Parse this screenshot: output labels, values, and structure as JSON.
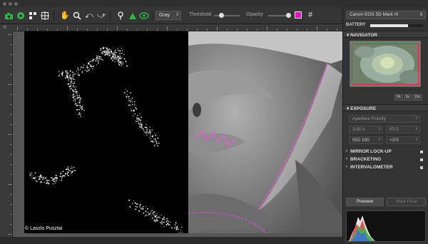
{
  "toolbar": {
    "mode_value": "Gray",
    "threshold_label": "Threshold",
    "threshold_level": 0.3,
    "opacity_label": "Opacity",
    "opacity_level": 0.9,
    "overlay_color": "#ff00d4",
    "icons": [
      "camera-green-icon",
      "live-view-icon",
      "focus-stack-icon",
      "crop-icon",
      "hand-icon",
      "magnifier-icon",
      "rotate-left-icon",
      "rotate-right-icon",
      "pin-icon",
      "mountain-icon",
      "eye-icon",
      "grid-icon"
    ]
  },
  "ruler": {
    "corner_label": "%"
  },
  "image": {
    "credit": "© Laszlo Pusztai"
  },
  "panel": {
    "camera_value": "Canon EOS 5D Mark III",
    "battery_label": "BATTERY",
    "battery_level": 0.72,
    "navigator": {
      "title": "NAVIGATOR",
      "zoom_options": [
        "Fit",
        "5x",
        "10x"
      ]
    },
    "exposure": {
      "title": "EXPOSURE",
      "mode_value": "Aperture Priority",
      "shutter": "1/20 s",
      "aperture": "f/3.5",
      "iso": "ISO 100",
      "ev": "+2/3"
    },
    "rows": [
      "MIRROR LOCK-UP",
      "BRACKETING",
      "INTERVALOMETER"
    ],
    "preview_label": "Preview",
    "mark_final_label": "Mark Final"
  },
  "colors": {
    "accent": "#2db84a",
    "overlay": "#ff00d4",
    "nav_frame": "#e2264d"
  }
}
